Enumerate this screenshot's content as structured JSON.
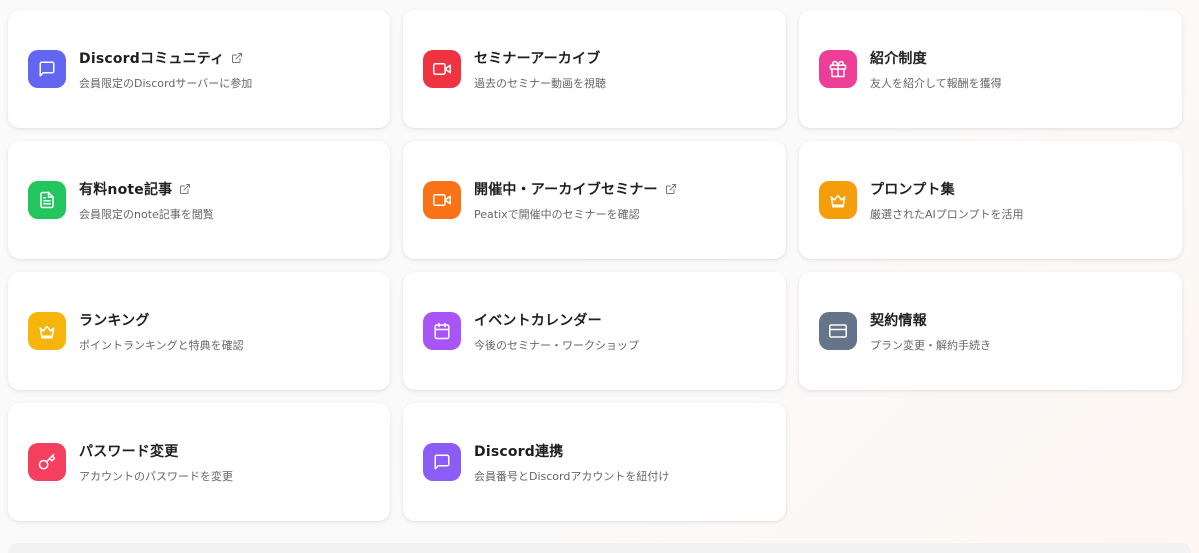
{
  "cards": [
    {
      "title": "Discordコミュニティ",
      "desc": "会員限定のDiscordサーバーに参加",
      "color": "#6366f1",
      "icon": "chat-icon",
      "external": true
    },
    {
      "title": "セミナーアーカイブ",
      "desc": "過去のセミナー動画を視聴",
      "color": "#ef3340",
      "icon": "video-icon",
      "external": false
    },
    {
      "title": "紹介制度",
      "desc": "友人を紹介して報酬を獲得",
      "color": "#ec3d97",
      "icon": "gift-icon",
      "external": false
    },
    {
      "title": "有料note記事",
      "desc": "会員限定のnote記事を閲覧",
      "color": "#22c55e",
      "icon": "document-icon",
      "external": true
    },
    {
      "title": "開催中・アーカイブセミナー",
      "desc": "Peatixで開催中のセミナーを確認",
      "color": "#f97316",
      "icon": "video-icon",
      "external": true
    },
    {
      "title": "プロンプト集",
      "desc": "厳選されたAIプロンプトを活用",
      "color": "#f59e0b",
      "icon": "crown-icon",
      "external": false
    },
    {
      "title": "ランキング",
      "desc": "ポイントランキングと特典を確認",
      "color": "#f5b50b",
      "icon": "crown-icon",
      "external": false
    },
    {
      "title": "イベントカレンダー",
      "desc": "今後のセミナー・ワークショップ",
      "color": "#a855f7",
      "icon": "calendar-icon",
      "external": false
    },
    {
      "title": "契約情報",
      "desc": "プラン変更・解約手続き",
      "color": "#64748b",
      "icon": "credit-card-icon",
      "external": false
    },
    {
      "title": "パスワード変更",
      "desc": "アカウントのパスワードを変更",
      "color": "#f43f5e",
      "icon": "key-icon",
      "external": false
    },
    {
      "title": "Discord連携",
      "desc": "会員番号とDiscordアカウントを紐付け",
      "color": "#8b5cf6",
      "icon": "chat-icon",
      "external": false
    }
  ]
}
